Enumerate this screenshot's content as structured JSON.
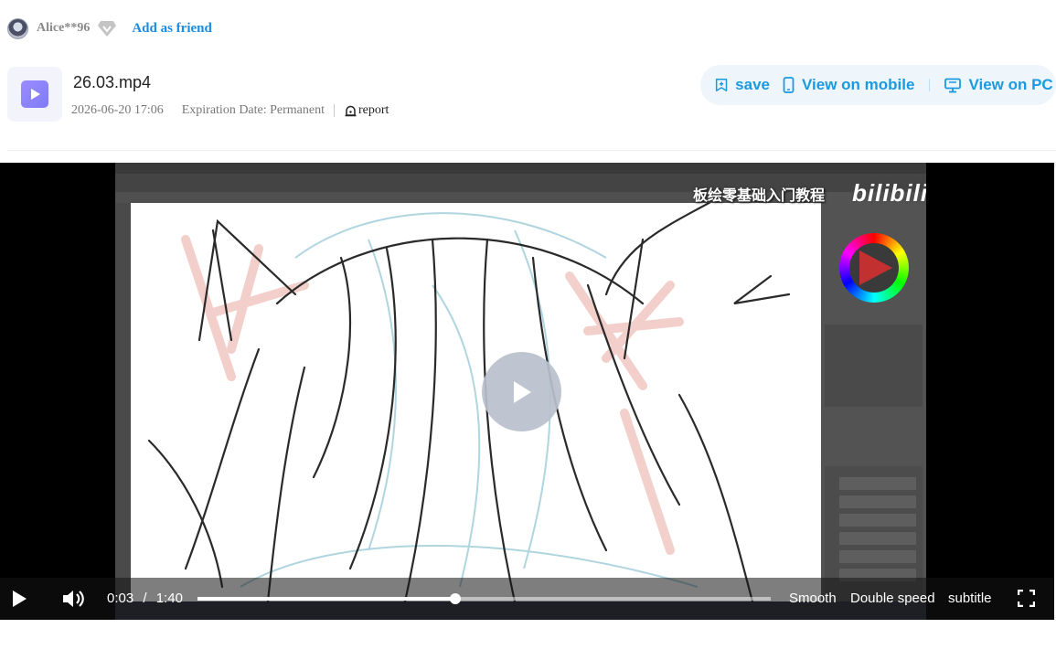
{
  "user": {
    "name": "Alice**96",
    "add_friend_label": "Add as friend"
  },
  "file": {
    "name": "26.03.mp4",
    "date": "2026-06-20 17:06",
    "expiration": "Expiration Date: Permanent",
    "report_label": "report"
  },
  "actions": {
    "save_label": "save",
    "mobile_label": "View on mobile",
    "pc_label": "View on PC"
  },
  "video": {
    "watermark_text": "板绘零基础入门教程",
    "watermark_logo": "bilibili",
    "current_time": "0:03",
    "time_separator": "/",
    "duration": "1:40",
    "progress": 0.449,
    "quality_label": "Smooth",
    "speed_label": "Double speed",
    "subtitle_label": "subtitle"
  },
  "colors": {
    "accent": "#1b9ae0",
    "link": "#1b8ce0",
    "action_bar_bg": "#eef6fc",
    "file_icon": "#8f86fb"
  },
  "icons": {
    "avatar": "avatar",
    "vip": "diamond-icon",
    "file": "video-file-icon",
    "report": "alarm-icon",
    "save": "bookmark-plus-icon",
    "mobile": "phone-icon",
    "pc": "monitor-icon",
    "play": "play-icon",
    "volume": "volume-icon",
    "fullscreen": "fullscreen-icon"
  }
}
